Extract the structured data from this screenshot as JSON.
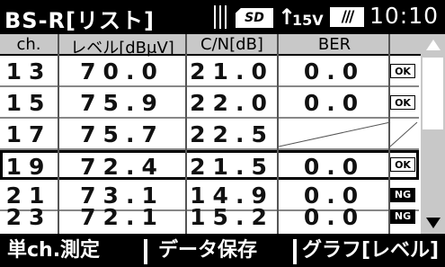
{
  "status_bar": {
    "title": "BS-R[リスト]",
    "sd_label": "SD",
    "arrow_icon": "up-arrow-icon",
    "voltage": "15V",
    "battery_label": "///",
    "time": "10:10"
  },
  "table": {
    "columns": [
      "ch.",
      "レベル[dBμV]",
      "C/N[dB]",
      "BER"
    ],
    "rows": [
      {
        "ch": "13",
        "level": "70.0",
        "cn": "21.0",
        "ber": "0.0",
        "badge": "OK"
      },
      {
        "ch": "15",
        "level": "75.9",
        "cn": "22.0",
        "ber": "0.0",
        "badge": "OK"
      },
      {
        "ch": "17",
        "level": "75.7",
        "cn": "22.5",
        "ber": "",
        "badge": ""
      },
      {
        "ch": "19",
        "level": "72.4",
        "cn": "21.5",
        "ber": "0.0",
        "badge": "OK"
      },
      {
        "ch": "21",
        "level": "73.1",
        "cn": "14.9",
        "ber": "0.0",
        "badge": "NG"
      },
      {
        "ch": "23",
        "level": "72.1",
        "cn": "15.2",
        "ber": "0.0",
        "badge": "NG"
      }
    ],
    "selected_row": 3
  },
  "footer": {
    "buttons": [
      "単ch.測定",
      "データ保存",
      "グラフ[レベル]"
    ]
  },
  "colors": {
    "background": "#000000",
    "table_bg": "#ffffff",
    "header_bg": "#c8c8c8",
    "ok_badge": "#ffffff",
    "ng_badge": "#000000"
  }
}
